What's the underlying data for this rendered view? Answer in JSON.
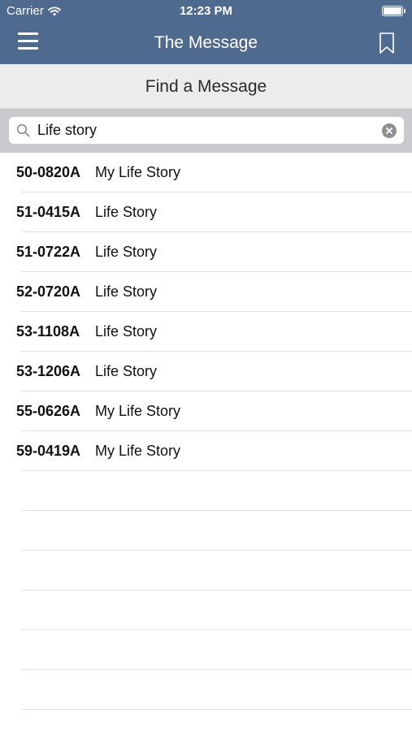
{
  "status_bar": {
    "carrier": "Carrier",
    "time": "12:23 PM"
  },
  "nav": {
    "title": "The Message",
    "menu_icon": "hamburger-menu-icon",
    "bookmark_icon": "bookmark-icon"
  },
  "header": {
    "title": "Find a Message"
  },
  "search": {
    "value": "Life story",
    "search_icon": "magnifier-icon",
    "clear_icon": "clear-circle-x-icon"
  },
  "results": [
    {
      "code": "50-0820A",
      "title": "My Life Story"
    },
    {
      "code": "51-0415A",
      "title": "Life Story"
    },
    {
      "code": "51-0722A",
      "title": "Life Story"
    },
    {
      "code": "52-0720A",
      "title": "Life Story"
    },
    {
      "code": "53-1108A",
      "title": "Life Story"
    },
    {
      "code": "53-1206A",
      "title": "Life Story"
    },
    {
      "code": "55-0626A",
      "title": "My Life Story"
    },
    {
      "code": "59-0419A",
      "title": "My Life Story"
    }
  ],
  "colors": {
    "nav_background": "#4e6a8f",
    "header_background": "#ececec",
    "search_area_background": "#c9c9ce"
  }
}
